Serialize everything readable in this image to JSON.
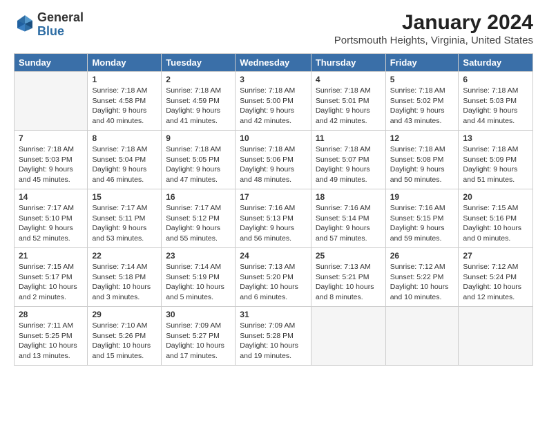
{
  "header": {
    "logo_line1": "General",
    "logo_line2": "Blue",
    "title": "January 2024",
    "subtitle": "Portsmouth Heights, Virginia, United States"
  },
  "days_of_week": [
    "Sunday",
    "Monday",
    "Tuesday",
    "Wednesday",
    "Thursday",
    "Friday",
    "Saturday"
  ],
  "weeks": [
    [
      {
        "day": "",
        "content": ""
      },
      {
        "day": "1",
        "content": "Sunrise: 7:18 AM\nSunset: 4:58 PM\nDaylight: 9 hours\nand 40 minutes."
      },
      {
        "day": "2",
        "content": "Sunrise: 7:18 AM\nSunset: 4:59 PM\nDaylight: 9 hours\nand 41 minutes."
      },
      {
        "day": "3",
        "content": "Sunrise: 7:18 AM\nSunset: 5:00 PM\nDaylight: 9 hours\nand 42 minutes."
      },
      {
        "day": "4",
        "content": "Sunrise: 7:18 AM\nSunset: 5:01 PM\nDaylight: 9 hours\nand 42 minutes."
      },
      {
        "day": "5",
        "content": "Sunrise: 7:18 AM\nSunset: 5:02 PM\nDaylight: 9 hours\nand 43 minutes."
      },
      {
        "day": "6",
        "content": "Sunrise: 7:18 AM\nSunset: 5:03 PM\nDaylight: 9 hours\nand 44 minutes."
      }
    ],
    [
      {
        "day": "7",
        "content": "Sunrise: 7:18 AM\nSunset: 5:03 PM\nDaylight: 9 hours\nand 45 minutes."
      },
      {
        "day": "8",
        "content": "Sunrise: 7:18 AM\nSunset: 5:04 PM\nDaylight: 9 hours\nand 46 minutes."
      },
      {
        "day": "9",
        "content": "Sunrise: 7:18 AM\nSunset: 5:05 PM\nDaylight: 9 hours\nand 47 minutes."
      },
      {
        "day": "10",
        "content": "Sunrise: 7:18 AM\nSunset: 5:06 PM\nDaylight: 9 hours\nand 48 minutes."
      },
      {
        "day": "11",
        "content": "Sunrise: 7:18 AM\nSunset: 5:07 PM\nDaylight: 9 hours\nand 49 minutes."
      },
      {
        "day": "12",
        "content": "Sunrise: 7:18 AM\nSunset: 5:08 PM\nDaylight: 9 hours\nand 50 minutes."
      },
      {
        "day": "13",
        "content": "Sunrise: 7:18 AM\nSunset: 5:09 PM\nDaylight: 9 hours\nand 51 minutes."
      }
    ],
    [
      {
        "day": "14",
        "content": "Sunrise: 7:17 AM\nSunset: 5:10 PM\nDaylight: 9 hours\nand 52 minutes."
      },
      {
        "day": "15",
        "content": "Sunrise: 7:17 AM\nSunset: 5:11 PM\nDaylight: 9 hours\nand 53 minutes."
      },
      {
        "day": "16",
        "content": "Sunrise: 7:17 AM\nSunset: 5:12 PM\nDaylight: 9 hours\nand 55 minutes."
      },
      {
        "day": "17",
        "content": "Sunrise: 7:16 AM\nSunset: 5:13 PM\nDaylight: 9 hours\nand 56 minutes."
      },
      {
        "day": "18",
        "content": "Sunrise: 7:16 AM\nSunset: 5:14 PM\nDaylight: 9 hours\nand 57 minutes."
      },
      {
        "day": "19",
        "content": "Sunrise: 7:16 AM\nSunset: 5:15 PM\nDaylight: 9 hours\nand 59 minutes."
      },
      {
        "day": "20",
        "content": "Sunrise: 7:15 AM\nSunset: 5:16 PM\nDaylight: 10 hours\nand 0 minutes."
      }
    ],
    [
      {
        "day": "21",
        "content": "Sunrise: 7:15 AM\nSunset: 5:17 PM\nDaylight: 10 hours\nand 2 minutes."
      },
      {
        "day": "22",
        "content": "Sunrise: 7:14 AM\nSunset: 5:18 PM\nDaylight: 10 hours\nand 3 minutes."
      },
      {
        "day": "23",
        "content": "Sunrise: 7:14 AM\nSunset: 5:19 PM\nDaylight: 10 hours\nand 5 minutes."
      },
      {
        "day": "24",
        "content": "Sunrise: 7:13 AM\nSunset: 5:20 PM\nDaylight: 10 hours\nand 6 minutes."
      },
      {
        "day": "25",
        "content": "Sunrise: 7:13 AM\nSunset: 5:21 PM\nDaylight: 10 hours\nand 8 minutes."
      },
      {
        "day": "26",
        "content": "Sunrise: 7:12 AM\nSunset: 5:22 PM\nDaylight: 10 hours\nand 10 minutes."
      },
      {
        "day": "27",
        "content": "Sunrise: 7:12 AM\nSunset: 5:24 PM\nDaylight: 10 hours\nand 12 minutes."
      }
    ],
    [
      {
        "day": "28",
        "content": "Sunrise: 7:11 AM\nSunset: 5:25 PM\nDaylight: 10 hours\nand 13 minutes."
      },
      {
        "day": "29",
        "content": "Sunrise: 7:10 AM\nSunset: 5:26 PM\nDaylight: 10 hours\nand 15 minutes."
      },
      {
        "day": "30",
        "content": "Sunrise: 7:09 AM\nSunset: 5:27 PM\nDaylight: 10 hours\nand 17 minutes."
      },
      {
        "day": "31",
        "content": "Sunrise: 7:09 AM\nSunset: 5:28 PM\nDaylight: 10 hours\nand 19 minutes."
      },
      {
        "day": "",
        "content": ""
      },
      {
        "day": "",
        "content": ""
      },
      {
        "day": "",
        "content": ""
      }
    ]
  ]
}
